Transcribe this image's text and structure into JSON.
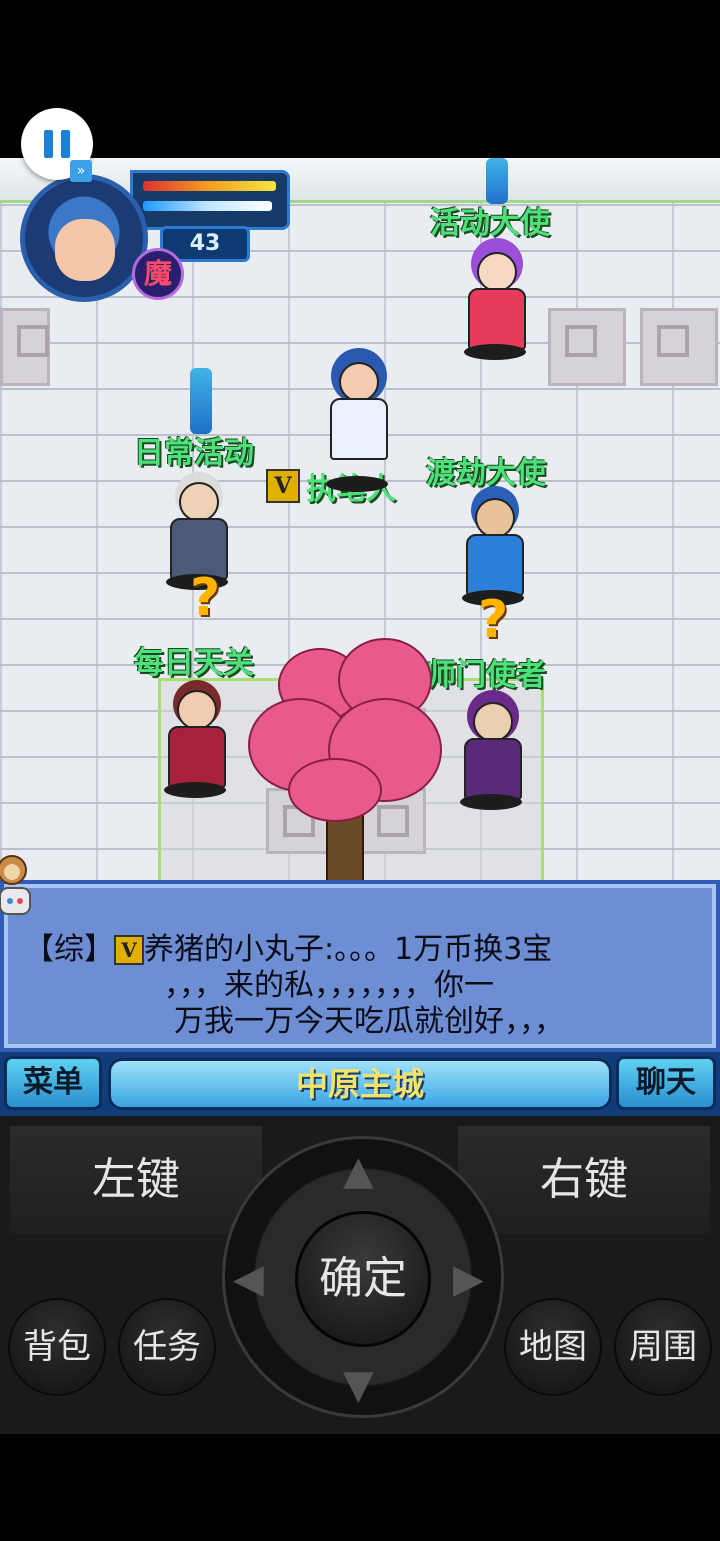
{
  "hud": {
    "level": "43",
    "faction_label": "魔",
    "hp_fraction": 0.95,
    "mp_fraction": 0.92
  },
  "player": {
    "vip_badge": "V",
    "name": "执笔人"
  },
  "npcs": {
    "activity_envoy": "活动大使",
    "daily_activity": "日常活动",
    "tribulation_envoy": "渡劫大使",
    "daily_heaven": "每日天关",
    "sect_envoy": "师门使者"
  },
  "quest_marker": "?",
  "chat": {
    "channel": "【综】",
    "vip_badge": "V",
    "line1": "养猪的小丸子:。。。1万币换3宝",
    "line2": "，，，来的私，，，，，，，你一",
    "line3": "万我一万今天吃瓜就创好，，，"
  },
  "status_bar": {
    "menu_label": "菜单",
    "location": "中原主城",
    "chat_label": "聊天"
  },
  "controls": {
    "left_key": "左键",
    "right_key": "右键",
    "ok": "确定",
    "backpack": "背包",
    "quest": "任务",
    "map": "地图",
    "nearby": "周围",
    "up_arrow": "▲",
    "down_arrow": "▼",
    "left_arrow": "◀",
    "right_arrow": "▶"
  },
  "colors": {
    "npc_label": "#4ee07a",
    "location_text": "#f4e36a",
    "chat_bg": "#6e8ed4"
  }
}
